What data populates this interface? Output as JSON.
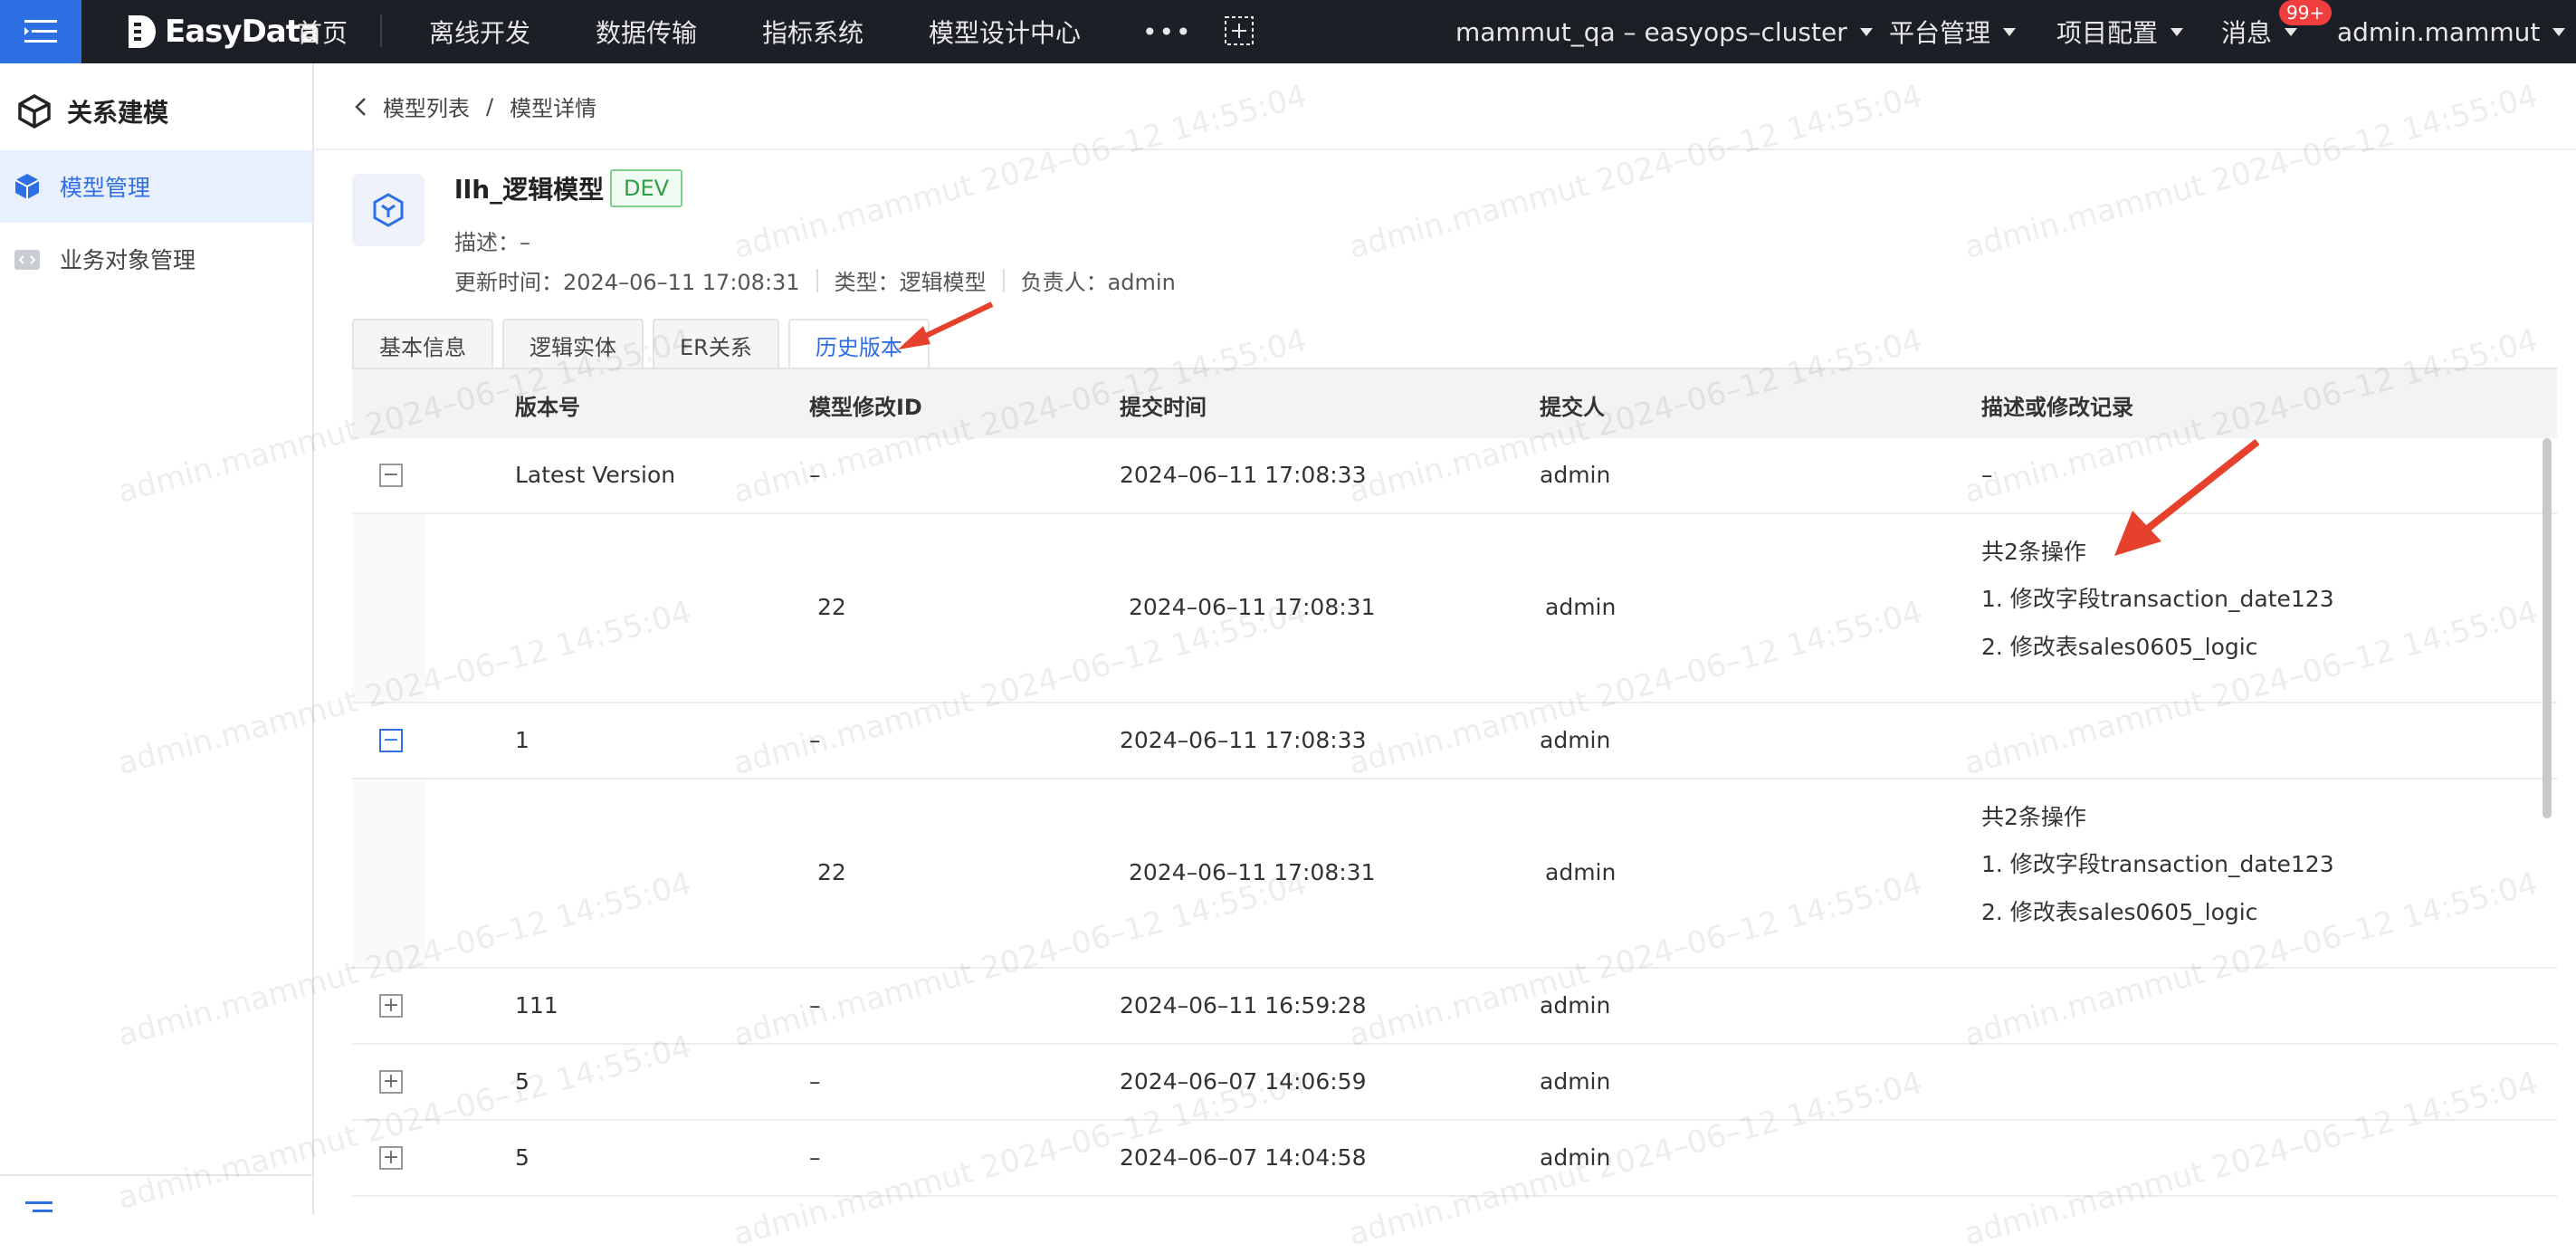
{
  "topbar": {
    "logo_text": "EasyData",
    "nav": [
      "首页",
      "离线开发",
      "数据传输",
      "指标系统",
      "模型设计中心"
    ],
    "more": "•••",
    "cluster": "mammut_qa – easyops–cluster",
    "platform": "平台管理",
    "project": "项目配置",
    "messages": "消息",
    "message_badge": "99+",
    "user": "admin.mammut"
  },
  "sidebar": {
    "title": "关系建模",
    "items": [
      {
        "label": "模型管理",
        "active": true
      },
      {
        "label": "业务对象管理",
        "active": false
      }
    ]
  },
  "breadcrumb": {
    "parent": "模型列表",
    "separator": "/",
    "current": "模型详情"
  },
  "model": {
    "name": "llh_逻辑模型",
    "env_tag": "DEV",
    "description": "描述：–",
    "update_time": "更新时间：2024–06–11 17:08:31",
    "type": "类型：逻辑模型",
    "owner": "负责人：admin"
  },
  "tabs": [
    {
      "label": "基本信息",
      "active": false
    },
    {
      "label": "逻辑实体",
      "active": false
    },
    {
      "label": "ER关系",
      "active": false
    },
    {
      "label": "历史版本",
      "active": true
    }
  ],
  "table": {
    "headers": [
      "版本号",
      "模型修改ID",
      "提交时间",
      "提交人",
      "描述或修改记录"
    ],
    "rows": [
      {
        "expand": "−",
        "version": "Latest Version",
        "mod_id": "–",
        "time": "2024–06–11 17:08:33",
        "user": "admin",
        "desc": "–"
      },
      {
        "sub": true,
        "mod_id": "22",
        "time": "2024–06–11 17:08:31",
        "user": "admin",
        "ops_title": "共2条操作",
        "ops": [
          "1. 修改字段transaction_date123",
          "2. 修改表sales0605_logic"
        ]
      },
      {
        "expand": "−",
        "version": "1",
        "mod_id": "–",
        "time": "2024–06–11 17:08:33",
        "user": "admin",
        "desc": ""
      },
      {
        "sub": true,
        "mod_id": "22",
        "time": "2024–06–11 17:08:31",
        "user": "admin",
        "ops_title": "共2条操作",
        "ops": [
          "1. 修改字段transaction_date123",
          "2. 修改表sales0605_logic"
        ]
      },
      {
        "expand": "+",
        "version": "111",
        "mod_id": "–",
        "time": "2024–06–11 16:59:28",
        "user": "admin",
        "desc": ""
      },
      {
        "expand": "+",
        "version": "5",
        "mod_id": "–",
        "time": "2024–06–07 14:06:59",
        "user": "admin",
        "desc": ""
      },
      {
        "expand": "+",
        "version": "5",
        "mod_id": "–",
        "time": "2024–06–07 14:04:58",
        "user": "admin",
        "desc": ""
      }
    ]
  },
  "watermark": "admin.mammut 2024–06–12 14:55:04",
  "colors": {
    "accent": "#2f6fe4",
    "topbar": "#1c1f26",
    "annotation": "#e5412d"
  }
}
